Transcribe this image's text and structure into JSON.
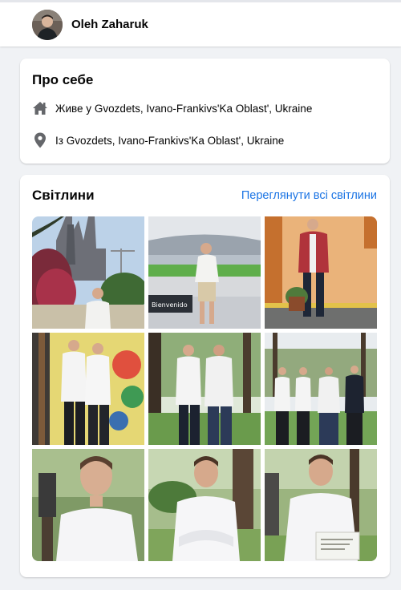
{
  "header": {
    "profile_name": "Oleh Zaharuk"
  },
  "about": {
    "title": "Про себе",
    "lives_prefix": "Живе у",
    "lives_place": "Gvozdets, Ivano-Frankivs'Ka Oblast', Ukraine",
    "from_prefix": "Із",
    "from_place": "Gvozdets, Ivano-Frankivs'Ka Oblast', Ukraine",
    "icons": [
      "home-icon",
      "location-pin-icon"
    ]
  },
  "photos": {
    "title": "Світлини",
    "see_all_label": "Переглянути всі світлини",
    "link_color": "#1b74e4",
    "items": [
      {
        "scene": "person in front of cathedral with red flowers"
      },
      {
        "scene": "person at stadium",
        "sign_text": "Bienvenido"
      },
      {
        "scene": "person in red jacket by orange wall"
      },
      {
        "scene": "two people in white shirts by mural"
      },
      {
        "scene": "two people in park"
      },
      {
        "scene": "four people in park"
      },
      {
        "scene": "portrait in white shirt with lantern"
      },
      {
        "scene": "portrait with arms crossed in park"
      },
      {
        "scene": "portrait holding diploma"
      }
    ]
  }
}
